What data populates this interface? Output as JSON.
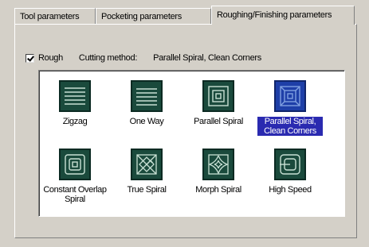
{
  "tabs": [
    {
      "label": "Tool parameters"
    },
    {
      "label": "Pocketing parameters"
    },
    {
      "label": "Roughing/Finishing parameters"
    }
  ],
  "rough": {
    "label": "Rough",
    "checked": true
  },
  "cutting_method": {
    "label": "Cutting method:",
    "value": "Parallel Spiral, Clean Corners"
  },
  "methods": [
    {
      "name": "Zigzag",
      "icon": "zigzag-icon"
    },
    {
      "name": "One Way",
      "icon": "one-way-icon"
    },
    {
      "name": "Parallel Spiral",
      "icon": "parallel-spiral-icon"
    },
    {
      "name": "Parallel Spiral, Clean Corners",
      "icon": "parallel-spiral-clean-corners-icon",
      "selected": true
    },
    {
      "name": "Constant Overlap Spiral",
      "icon": "constant-overlap-spiral-icon"
    },
    {
      "name": "True Spiral",
      "icon": "true-spiral-icon"
    },
    {
      "name": "Morph Spiral",
      "icon": "morph-spiral-icon"
    },
    {
      "name": "High Speed",
      "icon": "high-speed-icon"
    }
  ],
  "colors": {
    "icon_bg": "#1a4a3c",
    "icon_stroke": "#c8e0d4",
    "selected_bg": "#2a2ab0",
    "selected_icon": "#1e3fa8"
  }
}
